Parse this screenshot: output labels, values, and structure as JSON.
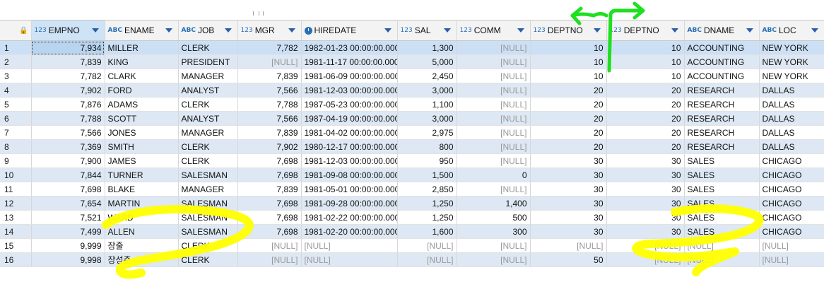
{
  "columns": [
    {
      "type": "",
      "name": "",
      "kind": "rownum"
    },
    {
      "type": "123",
      "name": "EMPNO",
      "kind": "num"
    },
    {
      "type": "ABC",
      "name": "ENAME",
      "kind": "text"
    },
    {
      "type": "ABC",
      "name": "JOB",
      "kind": "text"
    },
    {
      "type": "123",
      "name": "MGR",
      "kind": "num"
    },
    {
      "type": "clock",
      "name": "HIREDATE",
      "kind": "text"
    },
    {
      "type": "123",
      "name": "SAL",
      "kind": "num"
    },
    {
      "type": "123",
      "name": "COMM",
      "kind": "num"
    },
    {
      "type": "123",
      "name": "DEPTNO",
      "kind": "num"
    },
    {
      "type": "123",
      "name": "DEPTNO",
      "kind": "num"
    },
    {
      "type": "ABC",
      "name": "DNAME",
      "kind": "text"
    },
    {
      "type": "ABC",
      "name": "LOC",
      "kind": "text"
    }
  ],
  "rows": [
    [
      "1",
      "7,934",
      "MILLER",
      "CLERK",
      "7,782",
      "1982-01-23 00:00:00.000",
      "1,300",
      "[NULL]",
      "10",
      "10",
      "ACCOUNTING",
      "NEW YORK"
    ],
    [
      "2",
      "7,839",
      "KING",
      "PRESIDENT",
      "[NULL]",
      "1981-11-17 00:00:00.000",
      "5,000",
      "[NULL]",
      "10",
      "10",
      "ACCOUNTING",
      "NEW YORK"
    ],
    [
      "3",
      "7,782",
      "CLARK",
      "MANAGER",
      "7,839",
      "1981-06-09 00:00:00.000",
      "2,450",
      "[NULL]",
      "10",
      "10",
      "ACCOUNTING",
      "NEW YORK"
    ],
    [
      "4",
      "7,902",
      "FORD",
      "ANALYST",
      "7,566",
      "1981-12-03 00:00:00.000",
      "3,000",
      "[NULL]",
      "20",
      "20",
      "RESEARCH",
      "DALLAS"
    ],
    [
      "5",
      "7,876",
      "ADAMS",
      "CLERK",
      "7,788",
      "1987-05-23 00:00:00.000",
      "1,100",
      "[NULL]",
      "20",
      "20",
      "RESEARCH",
      "DALLAS"
    ],
    [
      "6",
      "7,788",
      "SCOTT",
      "ANALYST",
      "7,566",
      "1987-04-19 00:00:00.000",
      "3,000",
      "[NULL]",
      "20",
      "20",
      "RESEARCH",
      "DALLAS"
    ],
    [
      "7",
      "7,566",
      "JONES",
      "MANAGER",
      "7,839",
      "1981-04-02 00:00:00.000",
      "2,975",
      "[NULL]",
      "20",
      "20",
      "RESEARCH",
      "DALLAS"
    ],
    [
      "8",
      "7,369",
      "SMITH",
      "CLERK",
      "7,902",
      "1980-12-17 00:00:00.000",
      "800",
      "[NULL]",
      "20",
      "20",
      "RESEARCH",
      "DALLAS"
    ],
    [
      "9",
      "7,900",
      "JAMES",
      "CLERK",
      "7,698",
      "1981-12-03 00:00:00.000",
      "950",
      "[NULL]",
      "30",
      "30",
      "SALES",
      "CHICAGO"
    ],
    [
      "10",
      "7,844",
      "TURNER",
      "SALESMAN",
      "7,698",
      "1981-09-08 00:00:00.000",
      "1,500",
      "0",
      "30",
      "30",
      "SALES",
      "CHICAGO"
    ],
    [
      "11",
      "7,698",
      "BLAKE",
      "MANAGER",
      "7,839",
      "1981-05-01 00:00:00.000",
      "2,850",
      "[NULL]",
      "30",
      "30",
      "SALES",
      "CHICAGO"
    ],
    [
      "12",
      "7,654",
      "MARTIN",
      "SALESMAN",
      "7,698",
      "1981-09-28 00:00:00.000",
      "1,250",
      "1,400",
      "30",
      "30",
      "SALES",
      "CHICAGO"
    ],
    [
      "13",
      "7,521",
      "WARD",
      "SALESMAN",
      "7,698",
      "1981-02-22 00:00:00.000",
      "1,250",
      "500",
      "30",
      "30",
      "SALES",
      "CHICAGO"
    ],
    [
      "14",
      "7,499",
      "ALLEN",
      "SALESMAN",
      "7,698",
      "1981-02-20 00:00:00.000",
      "1,600",
      "300",
      "30",
      "30",
      "SALES",
      "CHICAGO"
    ],
    [
      "15",
      "9,999",
      "장줄",
      "CLERK",
      "[NULL]",
      "[NULL]",
      "[NULL]",
      "[NULL]",
      "[NULL]",
      "[NULL]",
      "[NULL]",
      "[NULL]"
    ],
    [
      "16",
      "9,998",
      "장성준",
      "CLERK",
      "[NULL]",
      "[NULL]",
      "[NULL]",
      "[NULL]",
      "50",
      "[NULL]",
      "[NULL]",
      "[NULL]"
    ]
  ],
  "colors": {
    "annotation_yellow": "#ffff00",
    "annotation_green": "#1ee020",
    "header_bg": "#f3f3f3",
    "selected_row": "#cce0f5",
    "null_text": "#9a9a9a"
  }
}
